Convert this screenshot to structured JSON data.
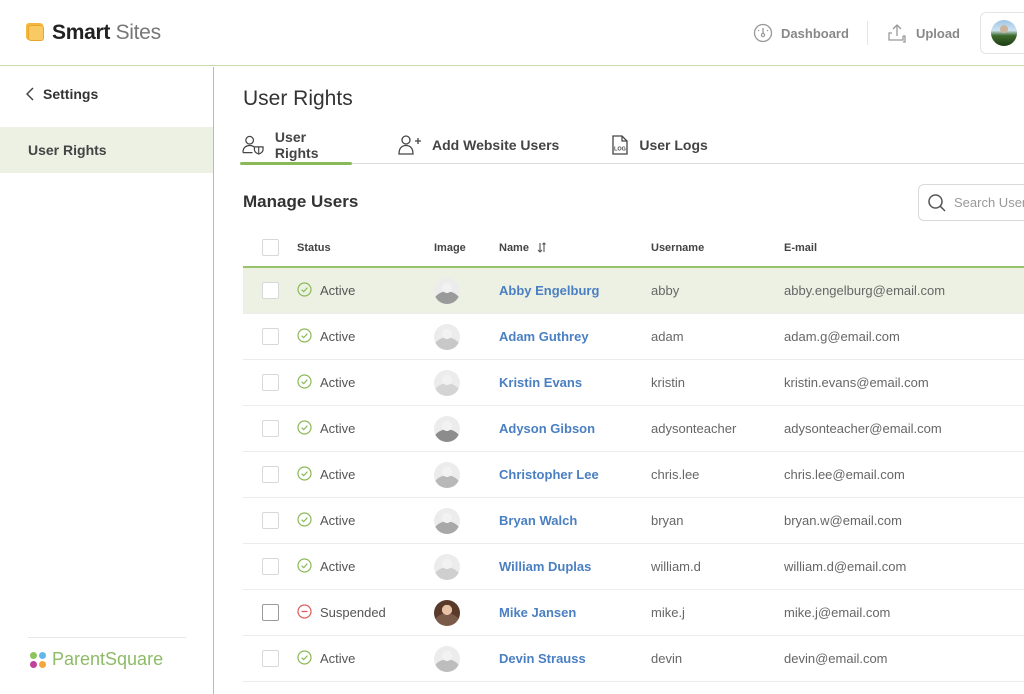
{
  "header": {
    "brand_bold": "Smart",
    "brand_light": "Sites",
    "dashboard_label": "Dashboard",
    "upload_label": "Upload"
  },
  "sidebar": {
    "back_label": "Settings",
    "items": [
      {
        "label": "User Rights",
        "active": true
      }
    ],
    "footer_brand": "ParentSquare"
  },
  "main": {
    "page_title": "User Rights",
    "tabs": [
      {
        "label": "User Rights",
        "icon": "user-shield-icon",
        "active": true
      },
      {
        "label": "Add Website Users",
        "icon": "user-add-icon",
        "active": false
      },
      {
        "label": "User Logs",
        "icon": "log-file-icon",
        "active": false
      }
    ],
    "section_title": "Manage Users",
    "search": {
      "placeholder": "Search User",
      "value": ""
    },
    "table": {
      "columns": [
        "Status",
        "Image",
        "Name",
        "Username",
        "E-mail"
      ],
      "sort_column": "Name",
      "rows": [
        {
          "status": "Active",
          "name": "Abby Engelburg",
          "username": "abby",
          "email": "abby.engelburg@email.com",
          "selected": true
        },
        {
          "status": "Active",
          "name": "Adam Guthrey",
          "username": "adam",
          "email": "adam.g@email.com",
          "selected": false
        },
        {
          "status": "Active",
          "name": "Kristin Evans",
          "username": "kristin",
          "email": "kristin.evans@email.com",
          "selected": false
        },
        {
          "status": "Active",
          "name": "Adyson Gibson",
          "username": "adysonteacher",
          "email": "adysonteacher@email.com",
          "selected": false
        },
        {
          "status": "Active",
          "name": "Christopher Lee",
          "username": "chris.lee",
          "email": "chris.lee@email.com",
          "selected": false
        },
        {
          "status": "Active",
          "name": "Bryan Walch",
          "username": "bryan",
          "email": "bryan.w@email.com",
          "selected": false
        },
        {
          "status": "Active",
          "name": "William Duplas",
          "username": "william.d",
          "email": "william.d@email.com",
          "selected": false
        },
        {
          "status": "Suspended",
          "name": "Mike Jansen",
          "username": "mike.j",
          "email": "mike.j@email.com",
          "selected": false
        },
        {
          "status": "Active",
          "name": "Devin Strauss",
          "username": "devin",
          "email": "devin@email.com",
          "selected": false
        }
      ]
    }
  },
  "colors": {
    "accent_green": "#8ab958",
    "selected_row": "#edf1e4",
    "link_blue": "#4a7fc1",
    "active_status": "#8ab958",
    "suspended_status": "#e05a5a",
    "brand_orange": "#f5b83d"
  }
}
